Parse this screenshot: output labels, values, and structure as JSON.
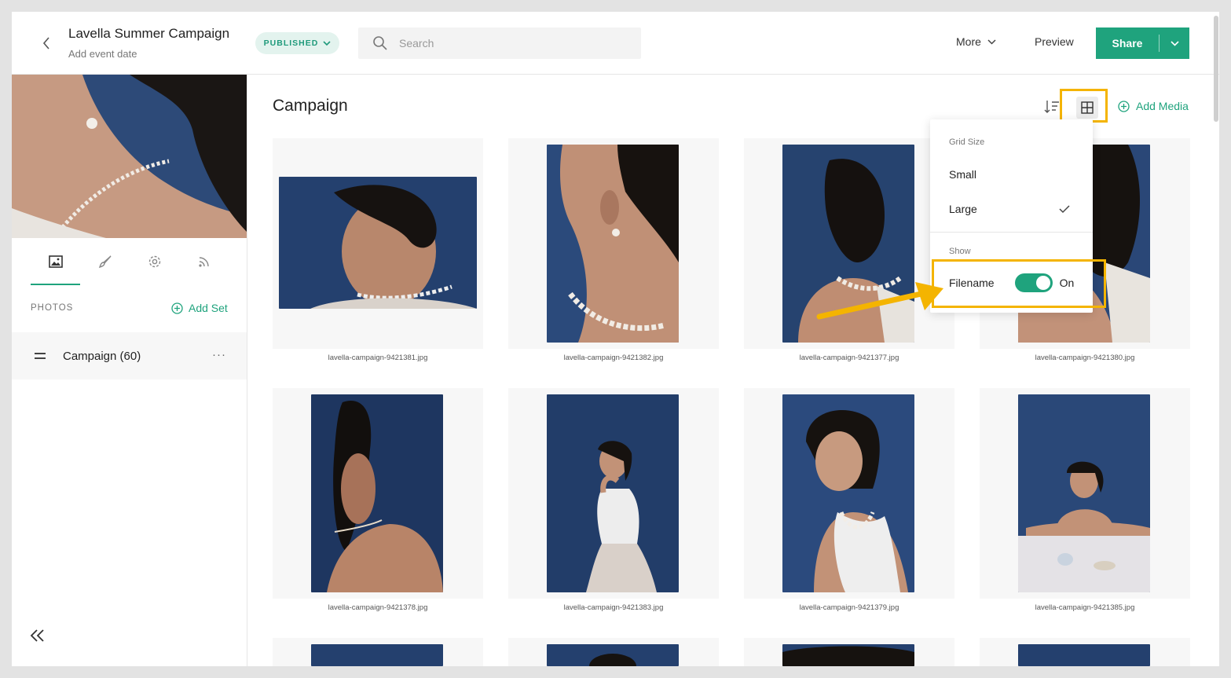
{
  "header": {
    "title": "Lavella Summer Campaign",
    "subtitle": "Add event date",
    "status": "PUBLISHED",
    "search_placeholder": "Search",
    "more_label": "More",
    "preview_label": "Preview",
    "share_label": "Share"
  },
  "sidebar": {
    "tabs": [
      {
        "name": "photos",
        "icon": "image-icon",
        "active": true
      },
      {
        "name": "design",
        "icon": "brush-icon",
        "active": false
      },
      {
        "name": "settings",
        "icon": "gear-icon",
        "active": false
      },
      {
        "name": "activity",
        "icon": "feed-icon",
        "active": false
      }
    ],
    "section_label": "PHOTOS",
    "add_set_label": "Add Set",
    "sets": [
      {
        "name": "Campaign (60)"
      }
    ],
    "set_more": "···"
  },
  "main": {
    "title": "Campaign",
    "add_media_label": "Add Media",
    "photos": [
      {
        "filename": "lavella-campaign-9421381.jpg"
      },
      {
        "filename": "lavella-campaign-9421382.jpg"
      },
      {
        "filename": "lavella-campaign-9421377.jpg"
      },
      {
        "filename": "lavella-campaign-9421380.jpg"
      },
      {
        "filename": "lavella-campaign-9421378.jpg"
      },
      {
        "filename": "lavella-campaign-9421383.jpg"
      },
      {
        "filename": "lavella-campaign-9421379.jpg"
      },
      {
        "filename": "lavella-campaign-9421385.jpg"
      }
    ]
  },
  "dropdown": {
    "grid_size_label": "Grid Size",
    "options": [
      "Small",
      "Large"
    ],
    "selected": "Large",
    "show_label": "Show",
    "filename_label": "Filename",
    "filename_state": "On"
  },
  "colors": {
    "accent": "#1fa37d",
    "highlight": "#f4b400",
    "photo_backdrop": "#24406e"
  }
}
